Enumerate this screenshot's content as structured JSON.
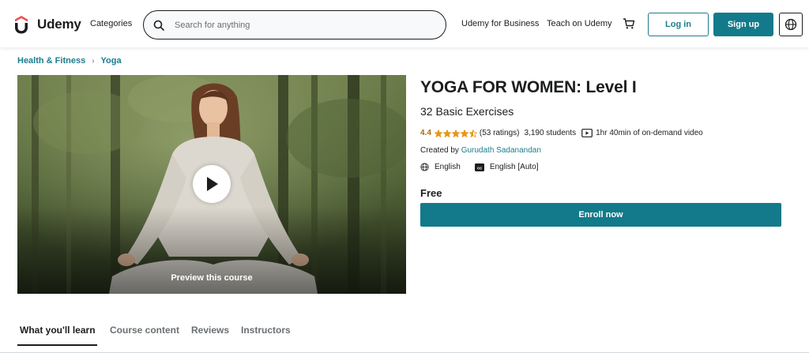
{
  "header": {
    "logo_text": "Udemy",
    "categories": "Categories",
    "search_placeholder": "Search for anything",
    "business": "Udemy for Business",
    "teach": "Teach on Udemy",
    "login": "Log in",
    "signup": "Sign up"
  },
  "breadcrumb": [
    "Health & Fitness",
    "Yoga"
  ],
  "preview": {
    "label": "Preview this course"
  },
  "course": {
    "title": "YOGA FOR WOMEN: Level I",
    "subtitle": "32 Basic Exercises",
    "rating": "4.4",
    "stars": 4.5,
    "rating_count": "(53 ratings)",
    "students": "3,190 students",
    "duration": "1hr 40min of on-demand video",
    "created_by_label": "Created by",
    "author": "Gurudath Sadanandan",
    "language": "English",
    "captions": "English [Auto]",
    "price": "Free",
    "enroll": "Enroll now"
  },
  "tabs": [
    "What you'll learn",
    "Course content",
    "Reviews",
    "Instructors"
  ],
  "colors": {
    "accent": "#127a8a",
    "link": "#1c7d8c",
    "star": "#e59819",
    "rating_text": "#b4690e",
    "logo": "#ec5252"
  },
  "icons": [
    "udemy-logo-icon",
    "search-icon",
    "cart-icon",
    "globe-icon",
    "play-icon",
    "star-icon",
    "video-icon",
    "cc-icon"
  ]
}
